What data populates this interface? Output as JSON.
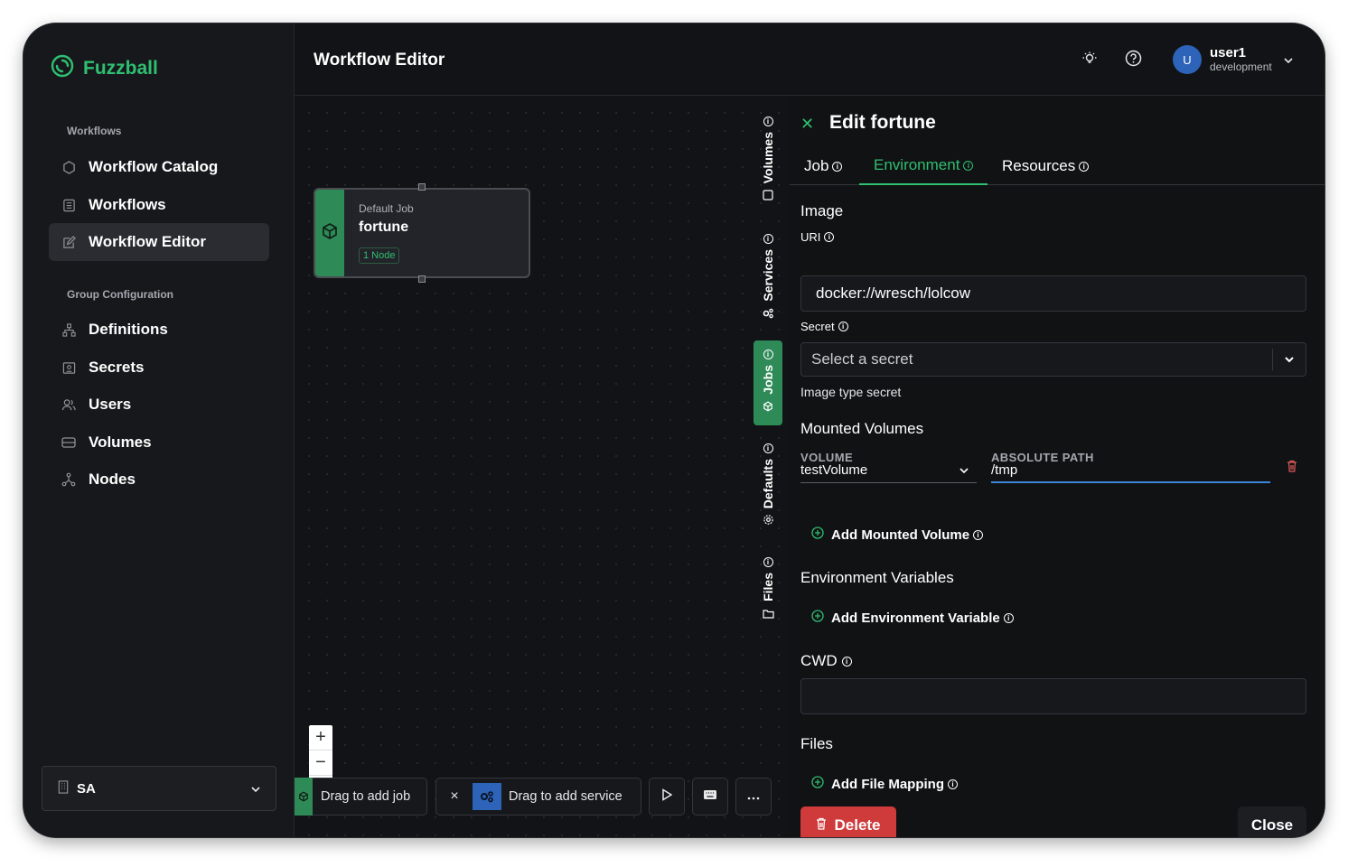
{
  "app": {
    "name": "Fuzzball"
  },
  "sidebar": {
    "section_workflows": "Workflows",
    "section_group": "Group Configuration",
    "items": [
      {
        "label": "Workflow Catalog",
        "icon": "hexagon-icon"
      },
      {
        "label": "Workflows",
        "icon": "list-icon"
      },
      {
        "label": "Workflow Editor",
        "icon": "edit-icon",
        "active": true
      },
      {
        "label": "Definitions",
        "icon": "sitemap-icon"
      },
      {
        "label": "Secrets",
        "icon": "key-card-icon"
      },
      {
        "label": "Users",
        "icon": "users-icon"
      },
      {
        "label": "Volumes",
        "icon": "drive-icon"
      },
      {
        "label": "Nodes",
        "icon": "nodes-icon"
      }
    ],
    "org": {
      "label": "SA"
    }
  },
  "header": {
    "title": "Workflow Editor",
    "user": {
      "initial": "U",
      "name": "user1",
      "org": "development"
    }
  },
  "canvas": {
    "job_node": {
      "subtitle": "Default Job",
      "name": "fortune",
      "badge": "1 Node"
    },
    "zoom_in": "+",
    "zoom_out": "−",
    "toolbar": {
      "add_job": "Drag to add job",
      "close": "×",
      "add_service": "Drag to add service"
    }
  },
  "rail": [
    "Volumes",
    "Services",
    "Jobs",
    "Defaults",
    "Files"
  ],
  "panel": {
    "title": "Edit fortune",
    "tabs": [
      "Job",
      "Environment",
      "Resources"
    ],
    "active_tab": "Environment",
    "image_heading": "Image",
    "uri_label": "URI",
    "uri_value": "docker://wresch/lolcow",
    "secret_label": "Secret",
    "secret_placeholder": "Select a secret",
    "secret_help": "Image type secret",
    "mounted_heading": "Mounted Volumes",
    "col_volume": "VOLUME",
    "col_path": "ABSOLUTE PATH",
    "mount": {
      "volume": "testVolume",
      "path": "/tmp"
    },
    "add_mount": "Add Mounted Volume",
    "env_heading": "Environment Variables",
    "add_env": "Add Environment Variable",
    "cwd_label": "CWD",
    "cwd_value": "",
    "files_heading": "Files",
    "add_file": "Add File Mapping",
    "delete_label": "Delete",
    "close_label": "Close"
  },
  "colors": {
    "accent": "#2fbf71",
    "danger": "#cf3a3a",
    "background": "#121316",
    "avatar": "#2d63b8"
  }
}
